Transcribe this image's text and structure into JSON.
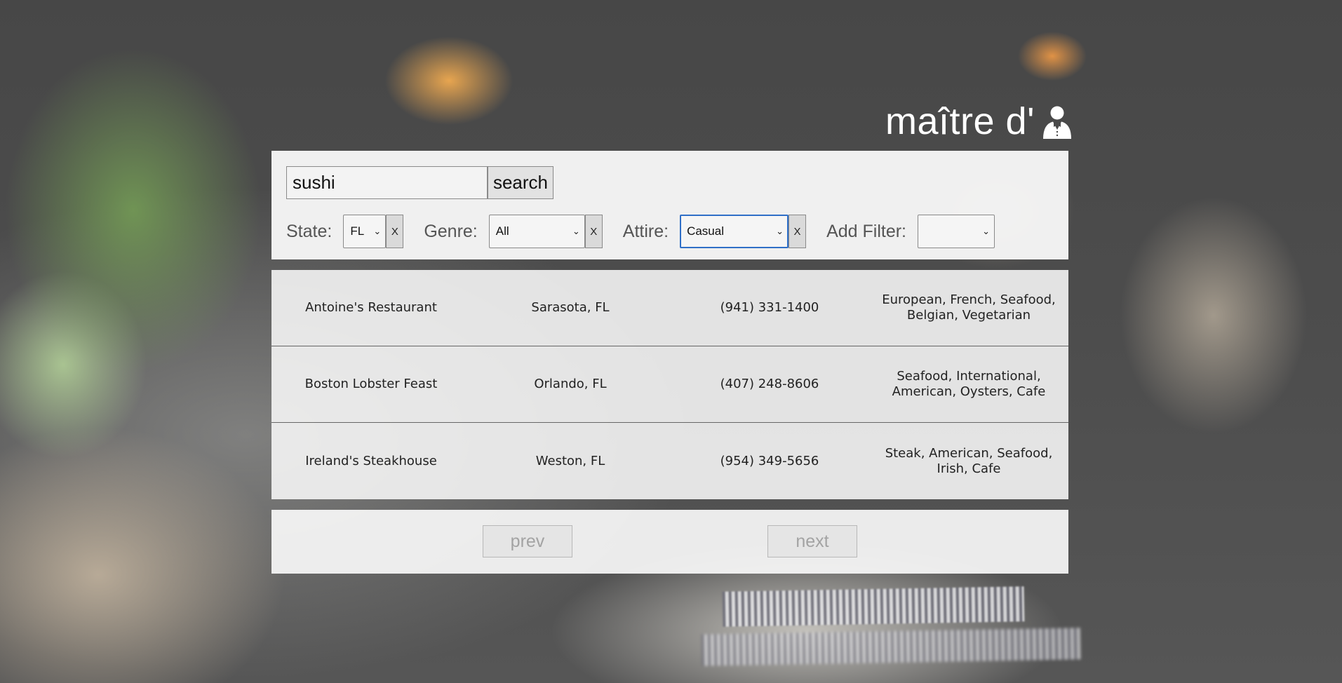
{
  "brand": {
    "name": "maître d'",
    "icon": "waiter-icon"
  },
  "search": {
    "value": "sushi",
    "button_label": "search"
  },
  "filters": [
    {
      "label": "State:",
      "selected": "FL",
      "clear_label": "X"
    },
    {
      "label": "Genre:",
      "selected": "All",
      "clear_label": "X"
    },
    {
      "label": "Attire:",
      "selected": "Casual",
      "clear_label": "X"
    }
  ],
  "add_filter": {
    "label": "Add Filter:",
    "selected": ""
  },
  "results": [
    {
      "name": "Antoine's Restaurant",
      "location": "Sarasota, FL",
      "phone": "(941) 331-1400",
      "cuisine": "European, French, Seafood, Belgian, Vegetarian"
    },
    {
      "name": "Boston Lobster Feast",
      "location": "Orlando, FL",
      "phone": "(407) 248-8606",
      "cuisine": "Seafood, International, American, Oysters, Cafe"
    },
    {
      "name": "Ireland's Steakhouse",
      "location": "Weston, FL",
      "phone": "(954) 349-5656",
      "cuisine": "Steak, American, Seafood, Irish, Cafe"
    }
  ],
  "pagination": {
    "prev_label": "prev",
    "next_label": "next"
  },
  "colors": {
    "focus": "#2f6fc7",
    "background": "#4a4a4a"
  }
}
